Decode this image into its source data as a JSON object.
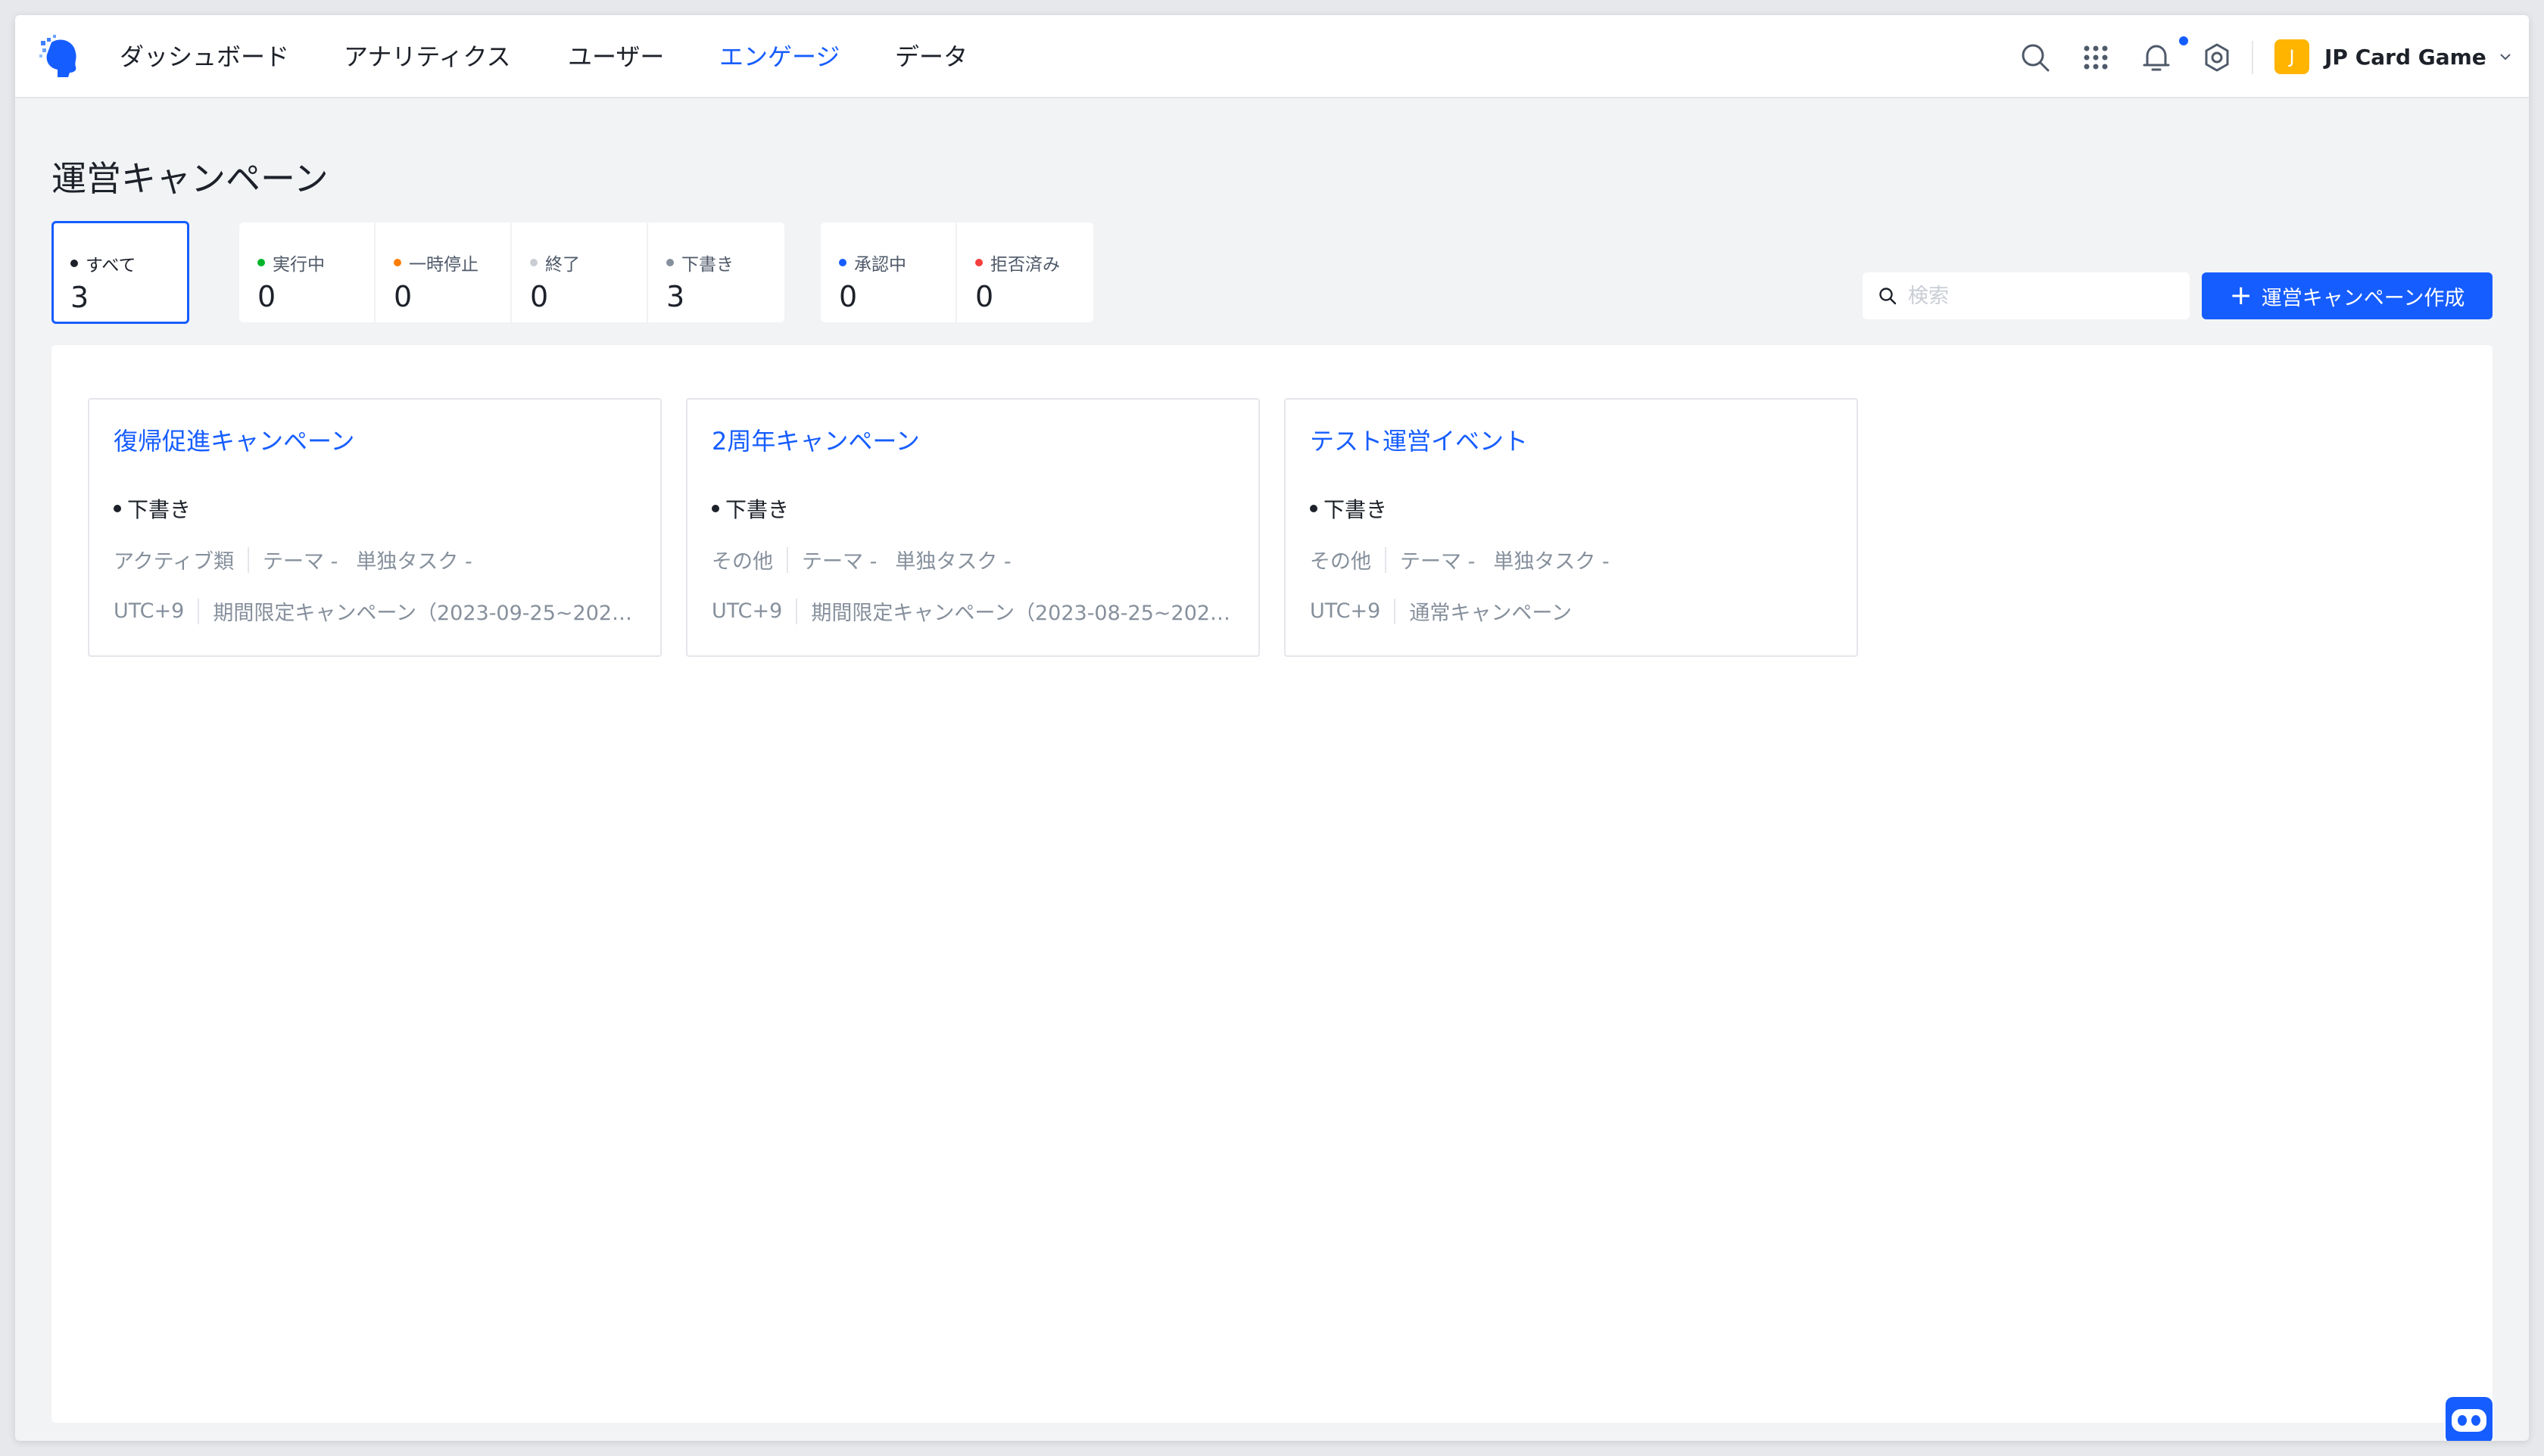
{
  "nav": {
    "items": [
      {
        "label": "ダッシュボード",
        "active": false
      },
      {
        "label": "アナリティクス",
        "active": false
      },
      {
        "label": "ユーザー",
        "active": false
      },
      {
        "label": "エンゲージ",
        "active": true
      },
      {
        "label": "データ",
        "active": false
      }
    ]
  },
  "account": {
    "initial": "J",
    "name": "JP Card Game"
  },
  "page": {
    "title": "運営キャンペーン"
  },
  "stats": {
    "all": {
      "label": "すべて",
      "value": "3"
    },
    "status": [
      {
        "label": "実行中",
        "value": "0",
        "color": "#00b42a"
      },
      {
        "label": "一時停止",
        "value": "0",
        "color": "#ff7d00"
      },
      {
        "label": "終了",
        "value": "0",
        "color": "#c9cdd4"
      },
      {
        "label": "下書き",
        "value": "3",
        "color": "#86909c"
      }
    ],
    "approval": [
      {
        "label": "承認中",
        "value": "0",
        "color": "#165dff"
      },
      {
        "label": "拒否済み",
        "value": "0",
        "color": "#f53f3f"
      }
    ]
  },
  "search": {
    "placeholder": "検索"
  },
  "create_button": {
    "label": "運営キャンペーン作成"
  },
  "campaigns": [
    {
      "title": "復帰促進キャンペーン",
      "status": "下書き",
      "category": "アクティブ類",
      "theme": "テーマ -",
      "task": "単独タスク -",
      "timezone": "UTC+9",
      "period": "期間限定キャンペーン（2023-09-25~2023-..."
    },
    {
      "title": "2周年キャンペーン",
      "status": "下書き",
      "category": "その他",
      "theme": "テーマ -",
      "task": "単独タスク -",
      "timezone": "UTC+9",
      "period": "期間限定キャンペーン（2023-08-25~2023-..."
    },
    {
      "title": "テスト運営イベント",
      "status": "下書き",
      "category": "その他",
      "theme": "テーマ -",
      "task": "単独タスク -",
      "timezone": "UTC+9",
      "period": "通常キャンペーン"
    }
  ],
  "colors": {
    "accent": "#165dff",
    "avatar": "#ffb400"
  }
}
